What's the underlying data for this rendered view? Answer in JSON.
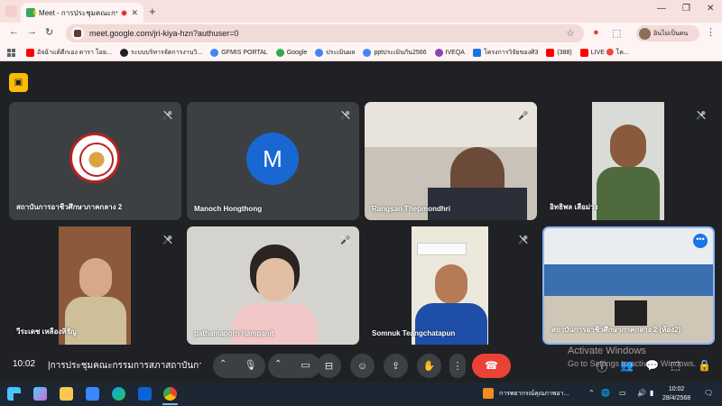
{
  "browser": {
    "tab_title": "Meet - การประชุมคณะกรรมกา",
    "new_tab": "+",
    "url": "meet.google.com/jri-kiya-hzn?authuser=0",
    "profile_label": "อินไม่เป็นคน",
    "window_controls": [
      "—",
      "❐",
      "✕"
    ]
  },
  "bookmarks": [
    {
      "label": "อัจฉ้าแด้ดีกเอง ดารา โอย...",
      "color": "#ff0000"
    },
    {
      "label": "ระบบบริหารจัดการงานวิ...",
      "color": "#202124"
    },
    {
      "label": "GFMIS PORTAL",
      "color": "#4285f4"
    },
    {
      "label": "Google",
      "color": "#34a853"
    },
    {
      "label": "ประเมินผล",
      "color": "#4285f4"
    },
    {
      "label": "pptประเมินกัน2566",
      "color": "#4285f4"
    },
    {
      "label": "IVEQA",
      "color": "#8e44ad"
    },
    {
      "label": "โครงการวิจัยของศิ3",
      "color": "#1a73e8"
    },
    {
      "label": "(388)",
      "color": "#ff0000"
    },
    {
      "label": "LIVE 🔴 โค...",
      "color": "#ff0000"
    }
  ],
  "participants": [
    {
      "name": "สถาบันการอาชีวศึกษาภาคกลาง 2",
      "kind": "seal"
    },
    {
      "name": "Manoch Hongthong",
      "kind": "letter",
      "initial": "M"
    },
    {
      "name": "Rangsan Thepmondhri",
      "kind": "video"
    },
    {
      "name": "อิทธิพล เสือม่วง",
      "kind": "video"
    },
    {
      "name": "วีระเดช เหลืองหิรัญ",
      "kind": "video"
    },
    {
      "name": "pathamaporn hampanit",
      "kind": "video"
    },
    {
      "name": "Somnuk Teangchatapun",
      "kind": "video"
    },
    {
      "name": "สถาบันการอาชีวศึกษาภาคกลาง 2 (ห้อง2)",
      "kind": "video",
      "active": true
    }
  ],
  "meeting": {
    "time": "10:02",
    "separator": "|",
    "name": "การประชุมคณะกรรมการสภาสถาบันการอาชี..."
  },
  "activation": {
    "line1": "Activate Windows",
    "line2": "Go to Settings to activate Windows."
  },
  "taskbar": {
    "notification": "การพยากรณ์คุณภาพอา...",
    "time": "10:02",
    "date": "28/4/2568"
  },
  "colors": {
    "meet_bg": "#202124",
    "tile_bg": "#3c4043",
    "hangup": "#ea4335",
    "accent": "#8ab4f8",
    "avatar_blue": "#1967d2"
  }
}
